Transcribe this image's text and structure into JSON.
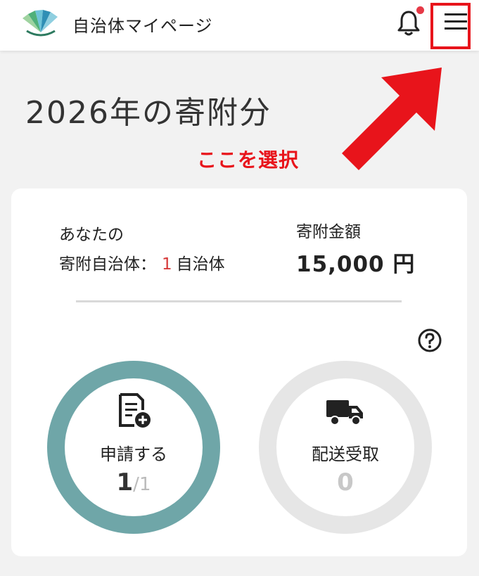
{
  "header": {
    "app_title": "自治体マイページ",
    "logo_icon": "fan-logo-icon",
    "notification_icon": "bell-icon",
    "menu_icon": "hamburger-menu-icon"
  },
  "annotation": {
    "callout": "ここを選択",
    "highlight_color": "#e8141b"
  },
  "main": {
    "year_title": "2026年の寄附分",
    "summary": {
      "your_label": "あなたの",
      "munis_label": "寄附自治体：",
      "munis_count": "1",
      "munis_unit": "自治体",
      "amount_label": "寄附金額",
      "amount_value": "15,000 円"
    },
    "progress": [
      {
        "label": "申請する",
        "value": "1",
        "slash": "/",
        "total": "1",
        "icon": "form-add-icon",
        "color": "#6fa6a8",
        "fraction": 1.0
      },
      {
        "label": "配送受取",
        "value": "0",
        "icon": "truck-icon",
        "color": "#e6e6e6",
        "fraction": 0.0
      }
    ]
  }
}
